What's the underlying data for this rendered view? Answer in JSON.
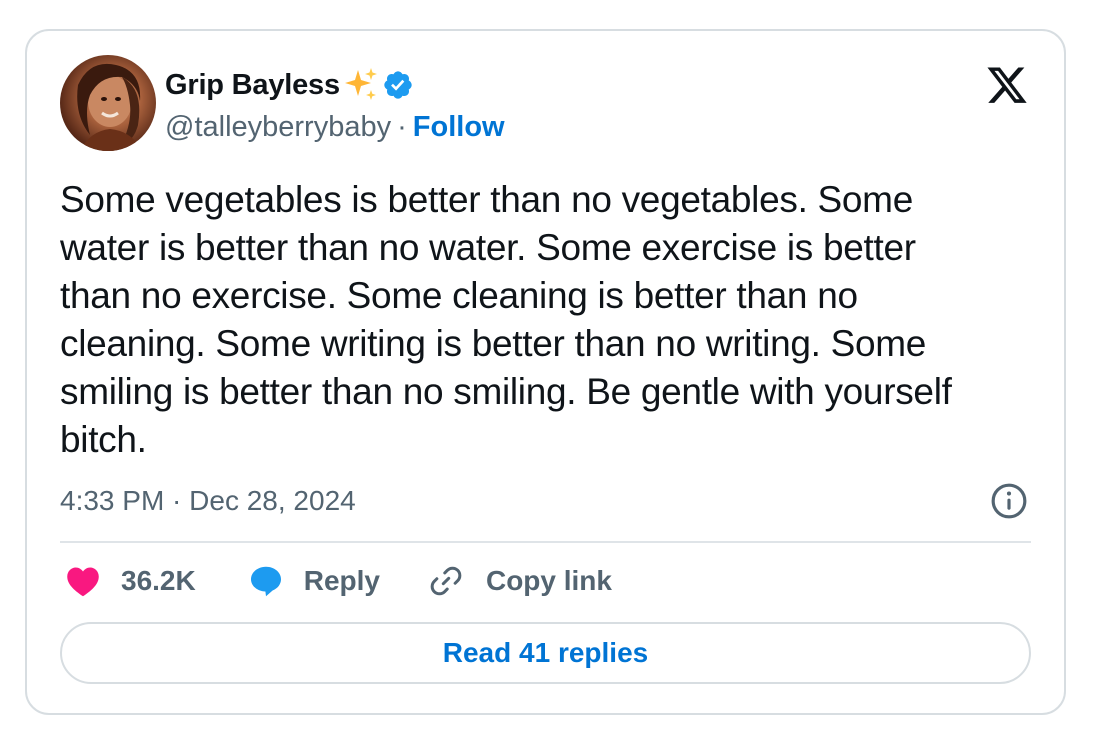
{
  "author": {
    "name": "Grip Bayless",
    "handle": "@talleyberrybaby",
    "separator": "·",
    "follow_label": "Follow",
    "verified": true
  },
  "icons": {
    "avatar": "profile-photo",
    "sparkle": "sparkles-emoji-icon",
    "verified": "verified-badge-icon",
    "logo": "x-logo-icon",
    "info": "info-icon",
    "like": "heart-icon",
    "reply": "speech-bubble-icon",
    "copy": "link-icon"
  },
  "tweet": {
    "text": "Some vegetables is better than no vegetables. Some\nwater is better than no water. Some exercise is better\nthan no exercise. Some cleaning is better than no\ncleaning. Some writing is better than no writing. Some\nsmiling is better than no smiling. Be gentle with yourself\nbitch.",
    "timestamp": "4:33 PM · Dec 28, 2024"
  },
  "actions": {
    "like_count": "36.2K",
    "reply_label": "Reply",
    "copy_label": "Copy link"
  },
  "read_replies_label": "Read 41 replies",
  "colors": {
    "text": "#0f1419",
    "secondary": "#536471",
    "accent": "#0074d4",
    "heart": "#f91880",
    "reply_bubble": "#1d9bf0",
    "border": "#d7dde1"
  }
}
